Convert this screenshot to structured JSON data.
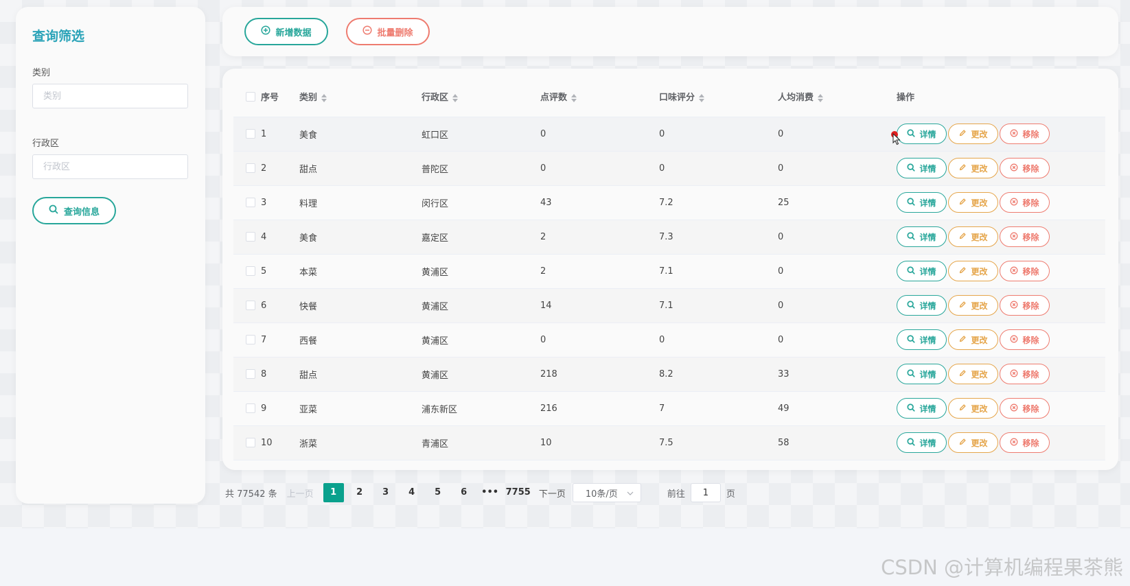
{
  "sidebar": {
    "title": "查询筛选",
    "category_label": "类别",
    "category_placeholder": "类别",
    "district_label": "行政区",
    "district_placeholder": "行政区",
    "query_button": "查询信息"
  },
  "toolbar": {
    "add_label": "新增数据",
    "batch_delete_label": "批量删除"
  },
  "table": {
    "columns": [
      "序号",
      "类别",
      "行政区",
      "点评数",
      "口味评分",
      "人均消费",
      "操作"
    ],
    "rows": [
      {
        "no": "1",
        "category": "美食",
        "district": "虹口区",
        "reviews": "0",
        "taste": "0",
        "avg": "0"
      },
      {
        "no": "2",
        "category": "甜点",
        "district": "普陀区",
        "reviews": "0",
        "taste": "0",
        "avg": "0"
      },
      {
        "no": "3",
        "category": "料理",
        "district": "闵行区",
        "reviews": "43",
        "taste": "7.2",
        "avg": "25"
      },
      {
        "no": "4",
        "category": "美食",
        "district": "嘉定区",
        "reviews": "2",
        "taste": "7.3",
        "avg": "0"
      },
      {
        "no": "5",
        "category": "本菜",
        "district": "黄浦区",
        "reviews": "2",
        "taste": "7.1",
        "avg": "0"
      },
      {
        "no": "6",
        "category": "快餐",
        "district": "黄浦区",
        "reviews": "14",
        "taste": "7.1",
        "avg": "0"
      },
      {
        "no": "7",
        "category": "西餐",
        "district": "黄浦区",
        "reviews": "0",
        "taste": "0",
        "avg": "0"
      },
      {
        "no": "8",
        "category": "甜点",
        "district": "黄浦区",
        "reviews": "218",
        "taste": "8.2",
        "avg": "33"
      },
      {
        "no": "9",
        "category": "亚菜",
        "district": "浦东新区",
        "reviews": "216",
        "taste": "7",
        "avg": "49"
      },
      {
        "no": "10",
        "category": "浙菜",
        "district": "青浦区",
        "reviews": "10",
        "taste": "7.5",
        "avg": "58"
      }
    ],
    "actions": {
      "detail": "详情",
      "edit": "更改",
      "remove": "移除"
    }
  },
  "pagination": {
    "total": "共 77542 条",
    "prev": "上一页",
    "pages": [
      "1",
      "2",
      "3",
      "4",
      "5",
      "6",
      "•••",
      "7755"
    ],
    "next": "下一页",
    "page_size": "10条/页",
    "goto_label": "前往",
    "goto_value": "1",
    "page_suffix": "页"
  },
  "watermark": "CSDN @计算机编程果茶熊",
  "colors": {
    "primary": "#27a69a",
    "warning": "#e5a54a",
    "danger": "#ee7b6f",
    "title": "#2aa3b8",
    "active_page": "#0aa18d"
  }
}
